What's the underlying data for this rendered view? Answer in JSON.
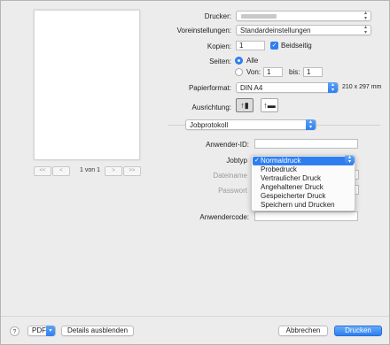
{
  "labels": {
    "drucker": "Drucker:",
    "voreinstellungen": "Voreinstellungen:",
    "kopien": "Kopien:",
    "seiten": "Seiten:",
    "papierformat": "Papierformat:",
    "ausrichtung": "Ausrichtung:",
    "anwender_id": "Anwender-ID:",
    "jobtyp": "Jobtyp",
    "dateiname": "Dateiname",
    "passwort": "Passwort",
    "anwendercode": "Anwendercode:"
  },
  "printer": {
    "value": ""
  },
  "presets": {
    "value": "Standardeinstellungen"
  },
  "copies": {
    "value": "1",
    "duplex_label": "Beidseitig",
    "duplex_checked": true
  },
  "pages": {
    "all_label": "Alle",
    "from_label": "Von:",
    "from_value": "1",
    "to_label": "bis:",
    "to_value": "1",
    "selected": "Alle"
  },
  "paper": {
    "value": "DIN A4",
    "size_text": "210 x 297 mm"
  },
  "panel": {
    "value": "Jobprotokoll"
  },
  "preview": {
    "page_text": "1 von 1",
    "first": "<<",
    "prev": "<",
    "next": ">",
    "last": ">>"
  },
  "jobtype_menu": {
    "items": [
      "Normaldruck",
      "Probedruck",
      "Vertraulicher Druck",
      "Angehaltener Druck",
      "Gespeicherter Druck",
      "Speichern und Drucken"
    ],
    "selected": "Normaldruck"
  },
  "footer": {
    "help": "?",
    "pdf": "PDF",
    "details": "Details ausblenden",
    "cancel": "Abbrechen",
    "print": "Drucken"
  },
  "colors": {
    "accent": "#2f7ef0",
    "window_bg": "#ececec"
  }
}
